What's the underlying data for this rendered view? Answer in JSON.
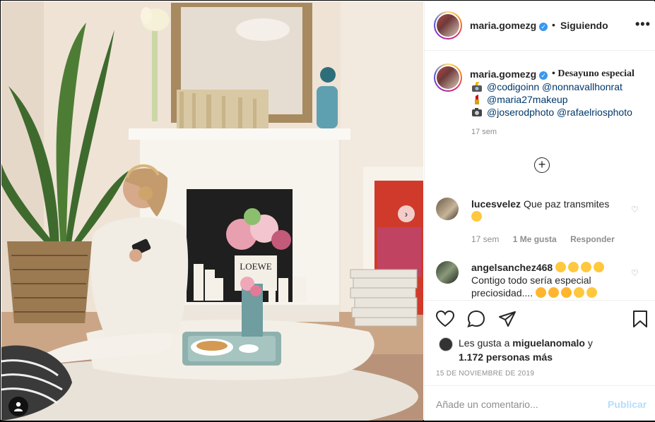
{
  "post": {
    "username": "maria.gomezg",
    "follow_separator": "•",
    "follow_status": "Siguiendo",
    "more_options": "•••"
  },
  "caption": {
    "username": "maria.gomezg",
    "title": "• Desayuno especial",
    "lines": [
      {
        "icon": "camera-flash-icon",
        "text": "@codigoinn @nonnavallhonrat"
      },
      {
        "icon": "lipstick-icon",
        "text": "@maria27makeup"
      },
      {
        "icon": "camera-icon",
        "text": "@joserodphoto @rafaelriosphoto"
      }
    ],
    "time": "17 sem",
    "load_more": "+"
  },
  "comments": [
    {
      "username": "lucesvelez",
      "text": "Que paz transmites",
      "time": "17 sem",
      "likes": "1 Me gusta",
      "reply": "Responder"
    },
    {
      "username": "angelsanchez468",
      "text": "Contigo todo sería especial preciosidad....",
      "time": "",
      "likes": "",
      "reply": ""
    }
  ],
  "likes": {
    "prefix": "Les gusta a",
    "user": "miguelanomalo",
    "suffix": "y",
    "others": "1.172 personas más"
  },
  "date": "15 DE NOVIEMBRE DE 2019",
  "comment_box": {
    "placeholder": "Añade un comentario...",
    "publish": "Publicar"
  },
  "photo": {
    "alt": "Woman with headphones sitting on the floor next to a fireplace with breakfast tray",
    "box_label": "LOEWE",
    "carousel_next": "›"
  },
  "colors": {
    "link": "#00376b",
    "muted": "#8e8e8e",
    "publish_disabled": "#b2dffc",
    "verified": "#3897f0"
  }
}
